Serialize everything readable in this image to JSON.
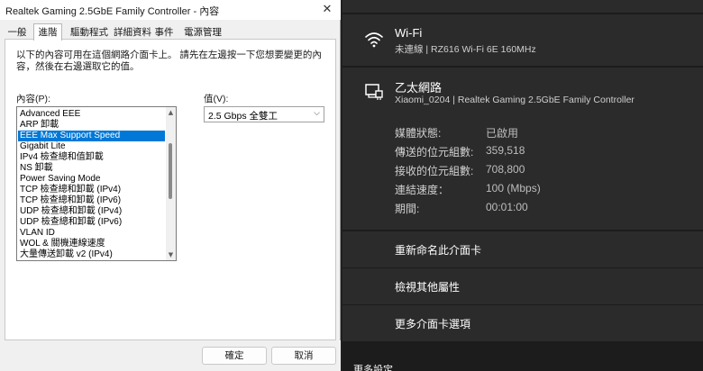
{
  "dialog": {
    "title": "Realtek Gaming 2.5GbE Family Controller - 內容",
    "close_glyph": "✕",
    "tabs": [
      "一般",
      "進階",
      "驅動程式",
      "詳細資料",
      "事件",
      "電源管理"
    ],
    "selected_tab": 1,
    "description_line1": "以下的內容可用在這個網路介面卡上。 請先在左邊按一下您想要變更的內",
    "description_line2": "容，然後在右邊選取它的值。",
    "property_label": "內容(P):",
    "value_label": "值(V):",
    "properties": [
      "Advanced EEE",
      "ARP 卸載",
      "EEE Max Support Speed",
      "Gigabit Lite",
      "IPv4 檢查總和值卸載",
      "NS 卸載",
      "Power Saving Mode",
      "TCP 檢查總和卸載 (IPv4)",
      "TCP 檢查總和卸載 (IPv6)",
      "UDP 檢查總和卸載 (IPv4)",
      "UDP 檢查總和卸載 (IPv6)",
      "VLAN ID",
      "WOL & 關機連線速度",
      "大量傳送卸載 v2 (IPv4)"
    ],
    "selected_property": 2,
    "value": "2.5 Gbps 全雙工",
    "ok_label": "確定",
    "cancel_label": "取消"
  },
  "panel": {
    "wifi": {
      "icon": "wifi-icon",
      "title": "Wi-Fi",
      "subtitle": "未連線 | RZ616 Wi-Fi 6E 160MHz"
    },
    "ethernet": {
      "icon": "ethernet-icon",
      "title": "乙太網路",
      "subtitle": "Xiaomi_0204 | Realtek Gaming 2.5GbE Family Controller",
      "stats": [
        {
          "key": "媒體狀態:",
          "value": "已啟用"
        },
        {
          "key": "傳送的位元組數:",
          "value": "359,518"
        },
        {
          "key": "接收的位元組數:",
          "value": "708,800"
        },
        {
          "key": "連結速度：",
          "value": "100 (Mbps)"
        },
        {
          "key": "期間:",
          "value": "00:01:00"
        }
      ]
    },
    "actions": [
      "重新命名此介面卡",
      "檢視其他屬性",
      "更多介面卡選項"
    ],
    "more_settings": "更多設定"
  }
}
